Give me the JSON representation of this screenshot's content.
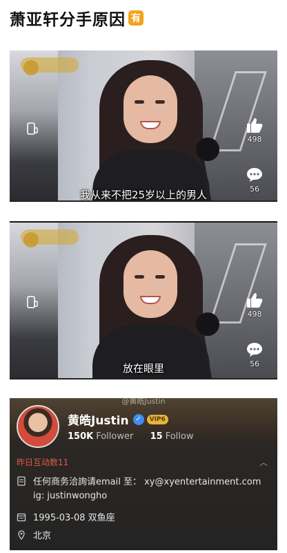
{
  "post": {
    "title": "萧亚轩分手原因",
    "badge": "有"
  },
  "videos": [
    {
      "subtitle": "我从来不把25岁以上的男人",
      "likes": "498",
      "comments": "56"
    },
    {
      "subtitle": "放在眼里",
      "likes": "498",
      "comments": "56"
    }
  ],
  "profile": {
    "watermark": "@黄皓Justin",
    "name": "黄皓Justin",
    "vip_label": "VIP6",
    "followers_count": "150K",
    "followers_label": "Follower",
    "following_count": "15",
    "following_label": "Follow",
    "interaction": "昨日互动数11",
    "collapse_icon": "chevron-up",
    "business": "任何商务洽詢请email 至：   xy@xyentertainment.com",
    "ig": "ig: justinwongho",
    "birthday": "1995-03-08 双鱼座",
    "location": "北京"
  },
  "colors": {
    "accent": "#e05a47",
    "verified": "#3d8df2",
    "badge": "#f3a31c"
  }
}
